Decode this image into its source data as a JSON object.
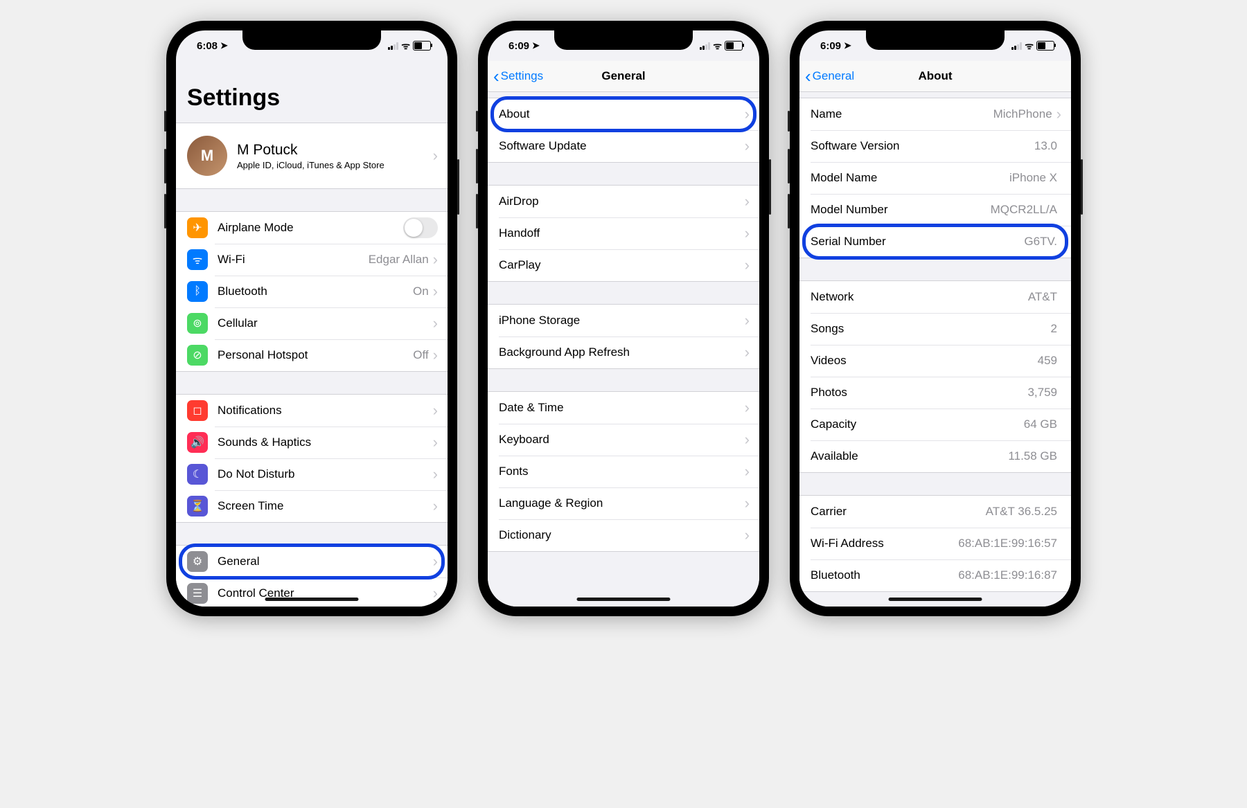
{
  "phone1": {
    "status": {
      "time": "6:08"
    },
    "title": "Settings",
    "profile": {
      "name": "M Potuck",
      "subtitle": "Apple ID, iCloud, iTunes & App Store"
    },
    "group2": [
      {
        "icon": "airplane-icon",
        "bg": "#ff9500",
        "glyph": "✈",
        "label": "Airplane Mode",
        "toggle": true
      },
      {
        "icon": "wifi-icon",
        "bg": "#007aff",
        "glyph": "ᯤ",
        "label": "Wi-Fi",
        "value": "Edgar Allan"
      },
      {
        "icon": "bluetooth-icon",
        "bg": "#007aff",
        "glyph": "ᛒ",
        "label": "Bluetooth",
        "value": "On"
      },
      {
        "icon": "cellular-icon",
        "bg": "#4cd964",
        "glyph": "⊚",
        "label": "Cellular"
      },
      {
        "icon": "hotspot-icon",
        "bg": "#4cd964",
        "glyph": "⊘",
        "label": "Personal Hotspot",
        "value": "Off"
      }
    ],
    "group3": [
      {
        "icon": "notifications-icon",
        "bg": "#ff3b30",
        "glyph": "◻",
        "label": "Notifications"
      },
      {
        "icon": "sounds-icon",
        "bg": "#ff2d55",
        "glyph": "🔊",
        "label": "Sounds & Haptics"
      },
      {
        "icon": "dnd-icon",
        "bg": "#5856d6",
        "glyph": "☾",
        "label": "Do Not Disturb"
      },
      {
        "icon": "screentime-icon",
        "bg": "#5856d6",
        "glyph": "⏳",
        "label": "Screen Time"
      }
    ],
    "group4": [
      {
        "icon": "general-icon",
        "bg": "#8e8e93",
        "glyph": "⚙",
        "label": "General",
        "highlight": true
      },
      {
        "icon": "controlcenter-icon",
        "bg": "#8e8e93",
        "glyph": "☰",
        "label": "Control Center"
      }
    ]
  },
  "phone2": {
    "status": {
      "time": "6:09"
    },
    "back": "Settings",
    "title": "General",
    "group1": [
      {
        "label": "About",
        "highlight": true
      },
      {
        "label": "Software Update"
      }
    ],
    "group2": [
      {
        "label": "AirDrop"
      },
      {
        "label": "Handoff"
      },
      {
        "label": "CarPlay"
      }
    ],
    "group3": [
      {
        "label": "iPhone Storage"
      },
      {
        "label": "Background App Refresh"
      }
    ],
    "group4": [
      {
        "label": "Date & Time"
      },
      {
        "label": "Keyboard"
      },
      {
        "label": "Fonts"
      },
      {
        "label": "Language & Region"
      },
      {
        "label": "Dictionary"
      }
    ]
  },
  "phone3": {
    "status": {
      "time": "6:09"
    },
    "back": "General",
    "title": "About",
    "group1": [
      {
        "label": "Name",
        "value": "MichPhone",
        "chevron": true
      },
      {
        "label": "Software Version",
        "value": "13.0"
      },
      {
        "label": "Model Name",
        "value": "iPhone X"
      },
      {
        "label": "Model Number",
        "value": "MQCR2LL/A"
      },
      {
        "label": "Serial Number",
        "value": "G6TV.",
        "highlight": true
      }
    ],
    "group2": [
      {
        "label": "Network",
        "value": "AT&T"
      },
      {
        "label": "Songs",
        "value": "2"
      },
      {
        "label": "Videos",
        "value": "459"
      },
      {
        "label": "Photos",
        "value": "3,759"
      },
      {
        "label": "Capacity",
        "value": "64 GB"
      },
      {
        "label": "Available",
        "value": "11.58 GB"
      }
    ],
    "group3": [
      {
        "label": "Carrier",
        "value": "AT&T 36.5.25"
      },
      {
        "label": "Wi-Fi Address",
        "value": "68:AB:1E:99:16:57"
      },
      {
        "label": "Bluetooth",
        "value": "68:AB:1E:99:16:87"
      }
    ]
  }
}
